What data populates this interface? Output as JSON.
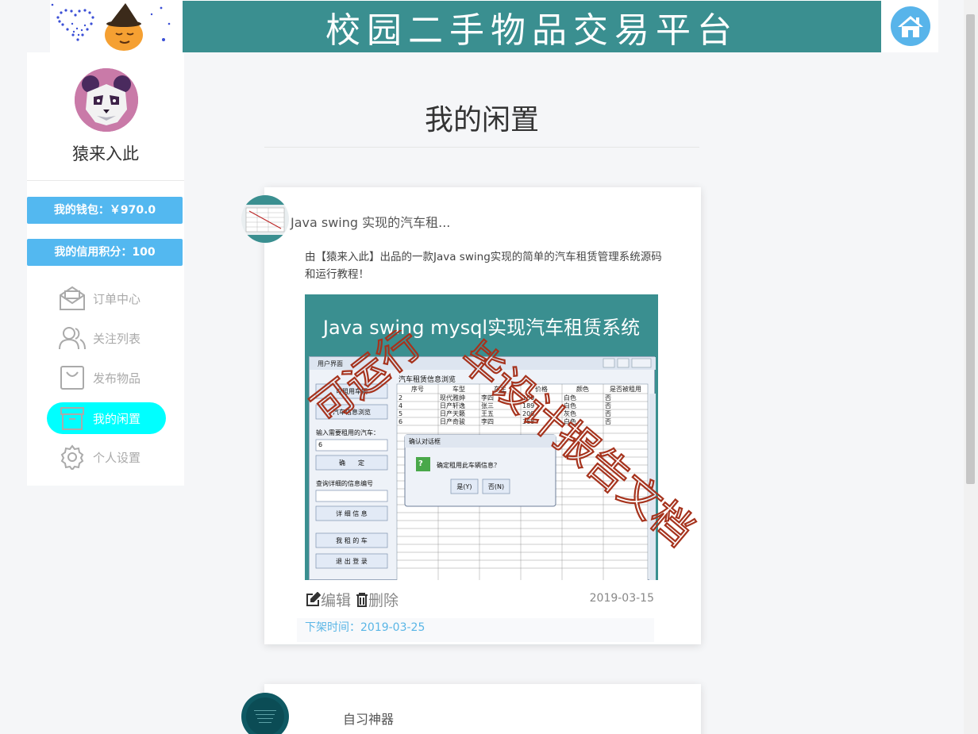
{
  "header": {
    "banner_title": "校园二手物品交易平台"
  },
  "user": {
    "name": "猿来入此",
    "wallet_label": "我的钱包：￥970.0",
    "credit_label": "我的信用积分：100"
  },
  "menu": [
    {
      "label": "订单中心",
      "icon": "envelope-icon"
    },
    {
      "label": "关注列表",
      "icon": "users-icon"
    },
    {
      "label": "发布物品",
      "icon": "bag-icon"
    },
    {
      "label": "我的闲置",
      "icon": "archive-icon",
      "active": true
    },
    {
      "label": "个人设置",
      "icon": "gear-icon"
    }
  ],
  "page": {
    "title": "我的闲置"
  },
  "items": [
    {
      "title": "Java swing 实现的汽车租...",
      "description": "由【猿来入此】出品的一款Java swing实现的简单的汽车租赁管理系统源码和运行教程！",
      "preview_heading": "Java swing mysql实现汽车租赁系统",
      "watermark": "可运行 毕设计报告文档",
      "edit_label": "编辑",
      "delete_label": "删除",
      "date": "2019-03-15",
      "offline_label": "下架时间：2019-03-25"
    },
    {
      "title": "自习神器"
    }
  ],
  "preview_window": {
    "title": "用户界面",
    "table_title": "汽车租赁信息浏览",
    "columns": [
      "序号",
      "车型",
      "车主",
      "价格",
      "颜色",
      "是否被租用"
    ],
    "rows": [
      [
        "2",
        "现代雅绅",
        "李四",
        "150",
        "白色",
        "否"
      ],
      [
        "4",
        "日产轩逸",
        "张三",
        "189",
        "白色",
        "否"
      ],
      [
        "5",
        "日产天籁",
        "王五",
        "200",
        "灰色",
        "否"
      ],
      [
        "6",
        "日产奇骏",
        "李四",
        "368",
        "白色",
        "否"
      ]
    ],
    "buttons": [
      "可租用车辆",
      "汽车信息浏览",
      "确　　定",
      "详 细 信 息",
      "我 租 的 车",
      "退 出 登 录"
    ],
    "input_label": "输入需要租用的汽车：",
    "input_value": "6",
    "query_label": "查询详细的信息编号",
    "dialog_title": "确认对话框",
    "dialog_text": "确定租用此车辆信息？",
    "dialog_yes": "是(Y)",
    "dialog_no": "否(N)"
  },
  "colors": {
    "banner": "#3a8f90",
    "badge": "#53b8f0",
    "active_menu": "#00ffff",
    "offline_text": "#5ab6e6"
  }
}
